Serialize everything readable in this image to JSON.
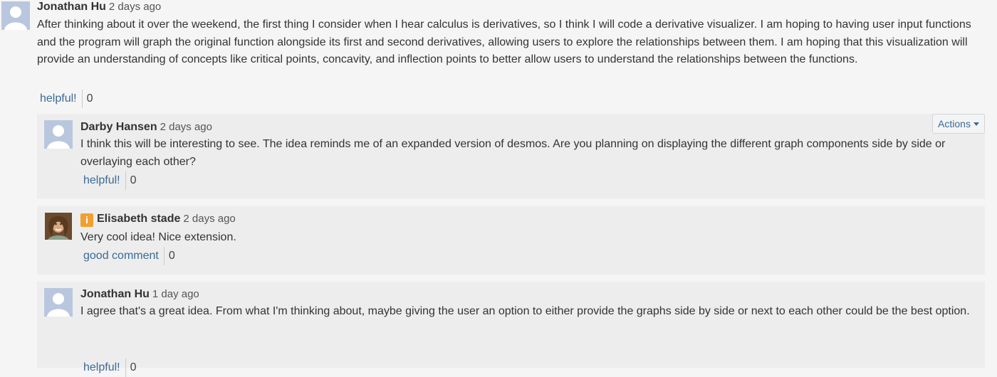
{
  "main_post": {
    "author": "Jonathan Hu",
    "time": "2 days ago",
    "text": "After thinking about it over the weekend, the first thing I consider when I hear calculus is derivatives, so I think I will code a derivative visualizer. I am hoping to having user input functions and the program will graph the original function alongside its first and second derivatives, allowing users to explore the relationships between them. I am hoping that this visualization will provide an understanding of concepts like critical points, concavity, and inflection points to better allow users to understand the relationships between the functions.",
    "vote_label": "helpful!",
    "vote_count": "0"
  },
  "replies": [
    {
      "author": "Darby Hansen",
      "time": "2 days ago",
      "text": "I think this will be interesting to see. The idea reminds me of an expanded version of desmos. Are you planning on displaying the different graph components side by side or overlaying each other?",
      "vote_label": "helpful!",
      "vote_count": "0",
      "actions_label": "Actions"
    },
    {
      "author": "Elisabeth stade",
      "badge": "i",
      "time": "2 days ago",
      "text": "Very cool idea! Nice extension.",
      "vote_label": "good comment",
      "vote_count": "0"
    },
    {
      "author": "Jonathan Hu",
      "time": "1 day ago",
      "text": "I agree that's a great idea. From what I'm thinking about, maybe giving the user an option to either provide the graphs side by side or next to each other could be the best option.",
      "vote_label": "helpful!",
      "vote_count": "0"
    }
  ],
  "colors": {
    "link": "#3a6a96",
    "avatar_bg": "#b9c7de",
    "badge": "#f0a030",
    "reply_bg": "#ededed"
  },
  "icons": {
    "default_avatar": "person-silhouette-icon",
    "info_badge": "info-badge-icon",
    "actions_caret": "caret-down-icon"
  }
}
